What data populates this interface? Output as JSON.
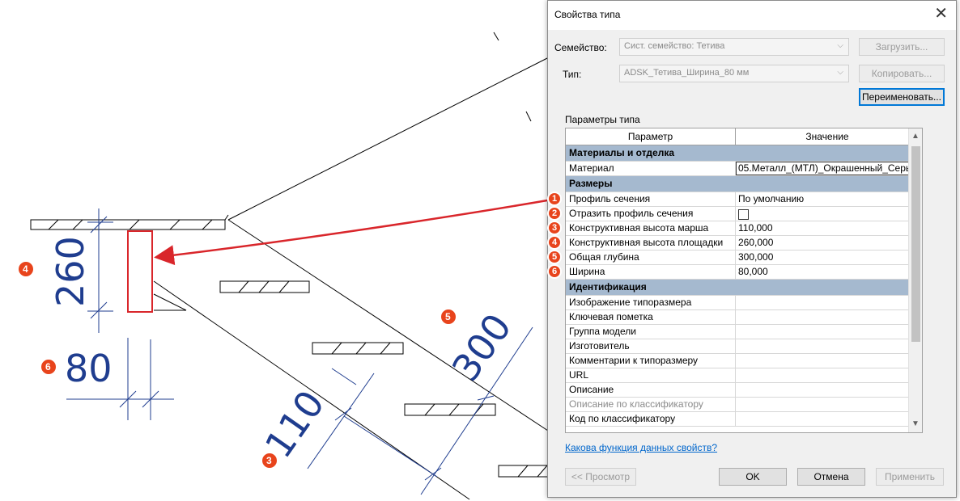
{
  "drawing": {
    "dims": {
      "d260": "260",
      "d80": "80",
      "d110": "110",
      "d300": "300"
    },
    "markers": [
      {
        "id": "m4",
        "label": "4"
      },
      {
        "id": "m6",
        "label": "6"
      },
      {
        "id": "m5",
        "label": "5"
      },
      {
        "id": "m3",
        "label": "3"
      }
    ],
    "colors": {
      "dim": "#1f3d8f",
      "arrow": "#d9262b",
      "badge": "#e8441c"
    }
  },
  "dialog": {
    "title": "Свойства типа",
    "family_label": "Семейство:",
    "family_value": "Сист. семейство: Тетива",
    "type_label": "Тип:",
    "type_value": "ADSK_Тетива_Ширина_80 мм",
    "load_button": "Загрузить...",
    "copy_button": "Копировать...",
    "rename_button": "Переименовать...",
    "params_label": "Параметры типа",
    "grid": {
      "col_param": "Параметр",
      "col_value": "Значение",
      "col_eq": "=",
      "groups": [
        {
          "title": "Материалы и отделка",
          "collapse": "⌃",
          "rows": [
            {
              "name": "Материал",
              "value": "05.Металл_(МТЛ)_Окрашенный_Серы",
              "edit": true
            }
          ]
        },
        {
          "title": "Размеры",
          "collapse": "⌃",
          "rows": [
            {
              "name": "Профиль сечения",
              "value": "По умолчанию",
              "badge": "1"
            },
            {
              "name": "Отразить профиль сечения",
              "value": "",
              "checkbox": true,
              "badge": "2"
            },
            {
              "name": "Конструктивная высота марша",
              "value": "110,000",
              "badge": "3"
            },
            {
              "name": "Конструктивная высота площадки",
              "value": "260,000",
              "badge": "4"
            },
            {
              "name": "Общая глубина",
              "value": "300,000",
              "badge": "5"
            },
            {
              "name": "Ширина",
              "value": "80,000",
              "badge": "6"
            }
          ]
        },
        {
          "title": "Идентификация",
          "collapse": "⌃",
          "rows": [
            {
              "name": "Изображение типоразмера",
              "value": ""
            },
            {
              "name": "Ключевая пометка",
              "value": ""
            },
            {
              "name": "Группа модели",
              "value": ""
            },
            {
              "name": "Изготовитель",
              "value": ""
            },
            {
              "name": "Комментарии к типоразмеру",
              "value": ""
            },
            {
              "name": "URL",
              "value": ""
            },
            {
              "name": "Описание",
              "value": ""
            },
            {
              "name": "Описание по классификатору",
              "value": "",
              "grey": true
            },
            {
              "name": "Код по классификатору",
              "value": ""
            }
          ]
        }
      ]
    },
    "help_link": "Какова функция данных свойств?",
    "preview_button": "<< Просмотр",
    "ok_button": "OK",
    "cancel_button": "Отмена",
    "apply_button": "Применить"
  }
}
